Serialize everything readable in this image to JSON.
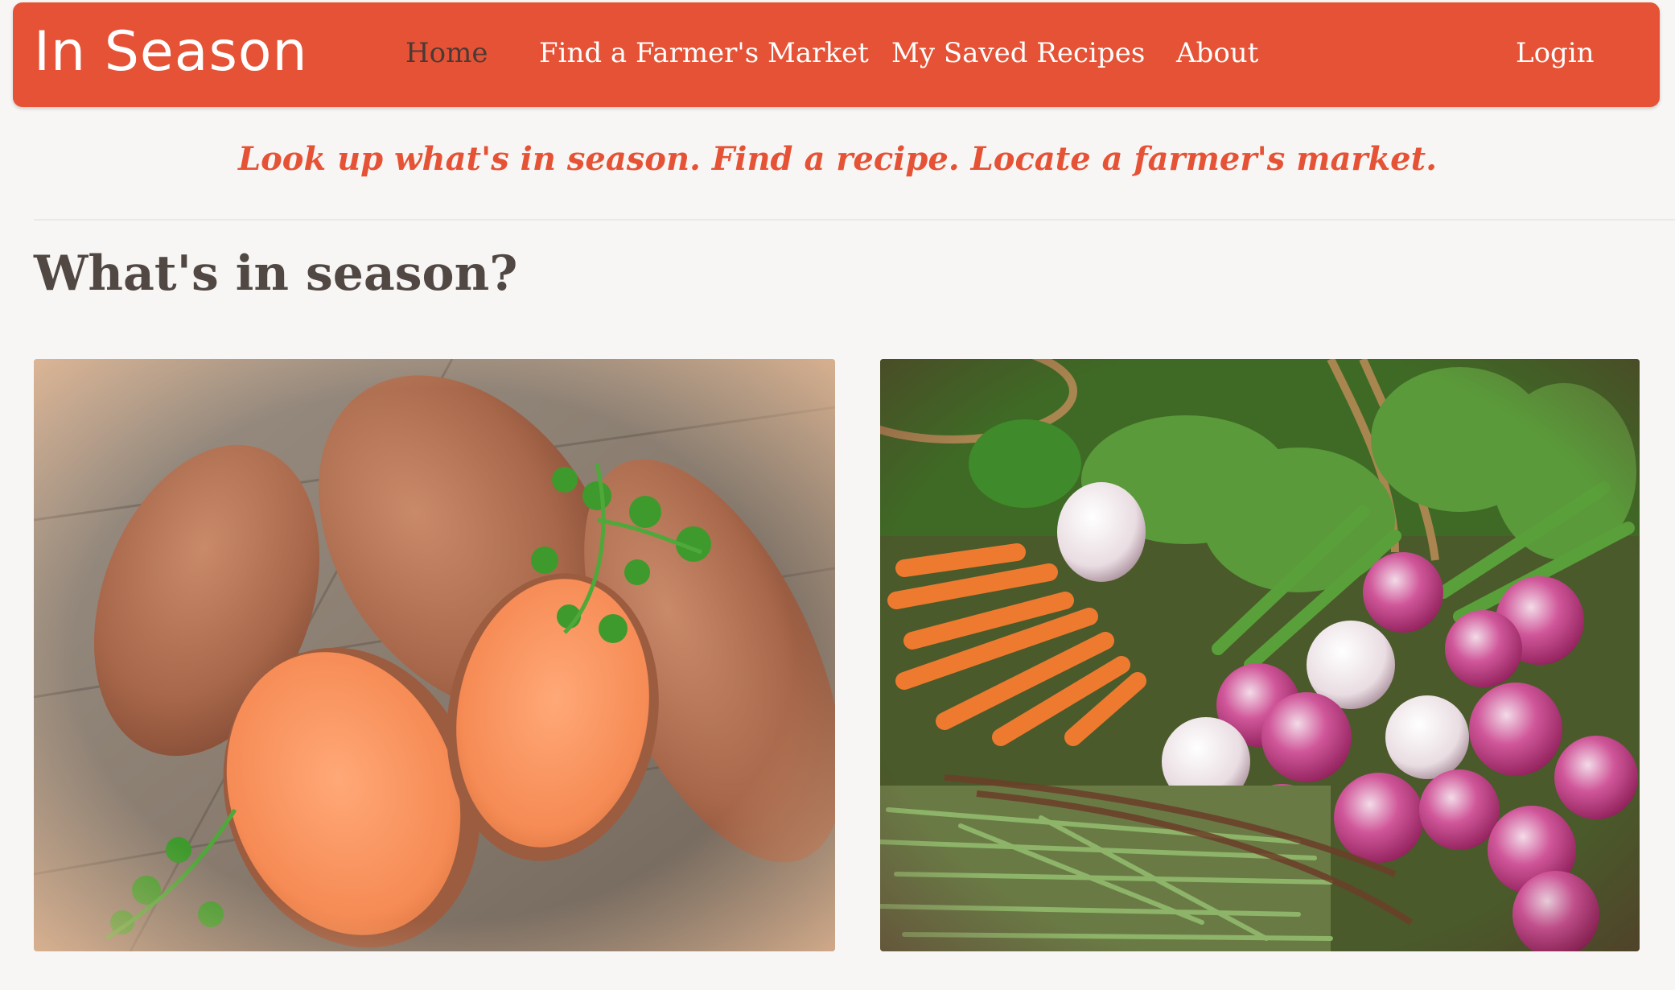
{
  "navbar": {
    "brand": "In Season",
    "items": [
      {
        "label": "Home",
        "active": true
      },
      {
        "label": "Find a Farmer's Market",
        "active": false
      },
      {
        "label": "My Saved Recipes",
        "active": false
      },
      {
        "label": "About",
        "active": false
      }
    ],
    "login_label": "Login"
  },
  "tagline": "Look up what's in season. Find a recipe. Locate a farmer's market.",
  "main": {
    "section_title": "What's in season?",
    "photos": [
      {
        "icon": "sweet-potatoes-image"
      },
      {
        "icon": "farmers-market-vegetables-image"
      }
    ]
  },
  "colors": {
    "brand": "#e55235",
    "active_nav_text": "#4a3a35",
    "heading": "#514844",
    "background": "#f8f6f4"
  }
}
